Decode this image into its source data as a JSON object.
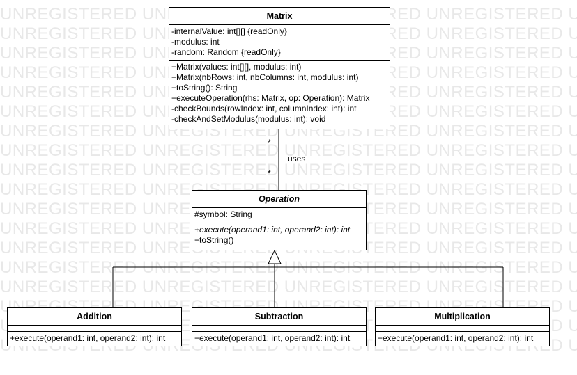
{
  "watermark": {
    "text": "UNREGISTERED UNREGISTERED UNREGISTERED UNREGISTERED UNREGISTERED UNREGISTERED"
  },
  "classes": {
    "matrix": {
      "name": "Matrix",
      "attributes": [
        "-internalValue: int[][] {readOnly}",
        "-modulus: int",
        "-random: Random {readOnly}"
      ],
      "operations": [
        "+Matrix(values: int[][], modulus: int)",
        "+Matrix(nbRows: int, nbColumns: int, modulus: int)",
        "+toString(): String",
        "+executeOperation(rhs: Matrix, op: Operation): Matrix",
        "-checkBounds(rowIndex: int, columnIndex: int): int",
        "-checkAndSetModulus(modulus: int): void"
      ]
    },
    "operation": {
      "name": "Operation",
      "attributes": [
        "#symbol: String"
      ],
      "operations": [
        "+execute(operand1: int, operand2: int): int",
        "+toString()"
      ]
    },
    "addition": {
      "name": "Addition",
      "operations": [
        "+execute(operand1: int, operand2: int): int"
      ]
    },
    "subtraction": {
      "name": "Subtraction",
      "operations": [
        "+execute(operand1: int, operand2: int): int"
      ]
    },
    "multiplication": {
      "name": "Multiplication",
      "operations": [
        "+execute(operand1: int, operand2: int): int"
      ]
    }
  },
  "association": {
    "label": "uses",
    "source_multiplicity": "*",
    "target_multiplicity": "*"
  }
}
